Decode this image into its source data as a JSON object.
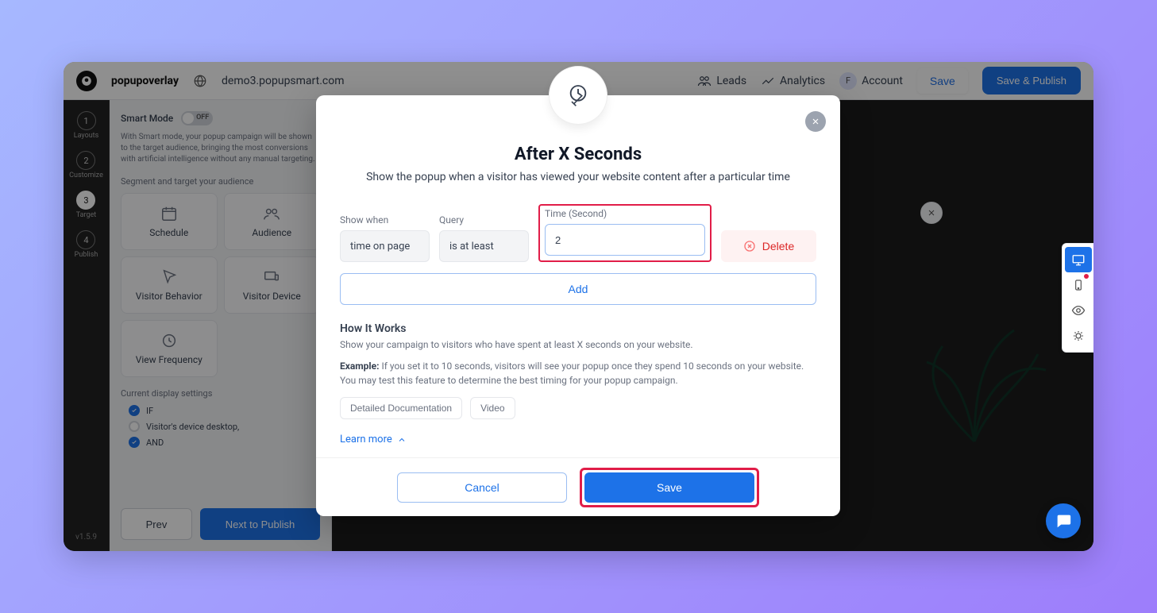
{
  "header": {
    "app_name": "popupoverlay",
    "url": "demo3.popupsmart.com",
    "leads": "Leads",
    "analytics": "Analytics",
    "account": "Account",
    "account_initial": "F",
    "save": "Save",
    "save_publish": "Save & Publish"
  },
  "left_rail": {
    "steps": [
      {
        "num": "1",
        "label": "Layouts"
      },
      {
        "num": "2",
        "label": "Customize"
      },
      {
        "num": "3",
        "label": "Target"
      },
      {
        "num": "4",
        "label": "Publish"
      }
    ],
    "version": "v1.5.9"
  },
  "sidebar": {
    "smart_mode_label": "Smart Mode",
    "toggle_state": "OFF",
    "smart_mode_desc": "With Smart mode, your popup campaign will be shown to the target audience, bringing the most conversions with artificial intelligence without any manual targeting.",
    "segment_label": "Segment and target your audience",
    "cards": [
      {
        "label": "Schedule"
      },
      {
        "label": "Audience"
      },
      {
        "label": "Visitor Behavior"
      },
      {
        "label": "Visitor Device"
      },
      {
        "label": "View Frequency"
      }
    ],
    "current_settings_label": "Current display settings",
    "rules": [
      {
        "type": "badge",
        "text": "IF"
      },
      {
        "type": "open",
        "text": "Visitor's device desktop,"
      },
      {
        "type": "badge",
        "text": "AND"
      }
    ],
    "prev": "Prev",
    "next": "Next to Publish"
  },
  "modal": {
    "title": "After X Seconds",
    "subtitle": "Show the popup when a visitor has viewed your website content after a particular time",
    "fields": {
      "show_when_label": "Show when",
      "show_when_value": "time on page",
      "query_label": "Query",
      "query_value": "is at least",
      "time_label": "Time (Second)",
      "time_value": "2"
    },
    "delete": "Delete",
    "add": "Add",
    "hiw_title": "How It Works",
    "hiw_text": "Show your campaign to visitors who have spent at least X seconds on your website.",
    "example_label": "Example:",
    "example_text": " If you set it to 10 seconds, visitors will see your popup once they spend 10 seconds on your website. You may test this feature to determine the best timing for your popup campaign.",
    "doc_btn": "Detailed Documentation",
    "video_btn": "Video",
    "learn_more": "Learn more",
    "cancel": "Cancel",
    "save": "Save"
  }
}
